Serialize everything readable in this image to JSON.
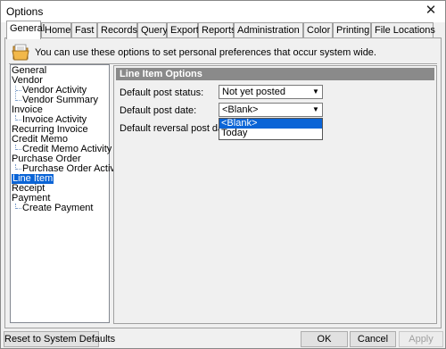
{
  "window": {
    "title": "Options"
  },
  "tabs": [
    {
      "label": "General"
    },
    {
      "label": "Home"
    },
    {
      "label": "Fast"
    },
    {
      "label": "Records"
    },
    {
      "label": "Query"
    },
    {
      "label": "Export"
    },
    {
      "label": "Reports"
    },
    {
      "label": "Administration"
    },
    {
      "label": "Color"
    },
    {
      "label": "Printing"
    },
    {
      "label": "File Locations"
    }
  ],
  "info_text": "You can use these options to set personal preferences that occur system wide.",
  "tree": {
    "items": [
      {
        "label": "General"
      },
      {
        "label": "Vendor"
      },
      {
        "label": "Vendor Activity"
      },
      {
        "label": "Vendor Summary"
      },
      {
        "label": "Invoice"
      },
      {
        "label": "Invoice Activity"
      },
      {
        "label": "Recurring Invoice"
      },
      {
        "label": "Credit Memo"
      },
      {
        "label": "Credit Memo Activity"
      },
      {
        "label": "Purchase Order"
      },
      {
        "label": "Purchase Order Activity"
      },
      {
        "label": "Line Item"
      },
      {
        "label": "Receipt"
      },
      {
        "label": "Payment"
      },
      {
        "label": "Create Payment"
      }
    ]
  },
  "panel": {
    "header": "Line Item Options",
    "fields": [
      {
        "label": "Default post status:",
        "value": "Not yet posted"
      },
      {
        "label": "Default post date:",
        "value": "<Blank>"
      },
      {
        "label": "Default reversal post date:",
        "value": ""
      }
    ],
    "dropdown_options": [
      "<Blank>",
      "Today"
    ]
  },
  "buttons": {
    "reset": "Reset to System Defaults",
    "ok": "OK",
    "cancel": "Cancel",
    "apply": "Apply"
  },
  "colors": {
    "selection": "#0a64d6",
    "panel_header": "#8a8a8a"
  }
}
